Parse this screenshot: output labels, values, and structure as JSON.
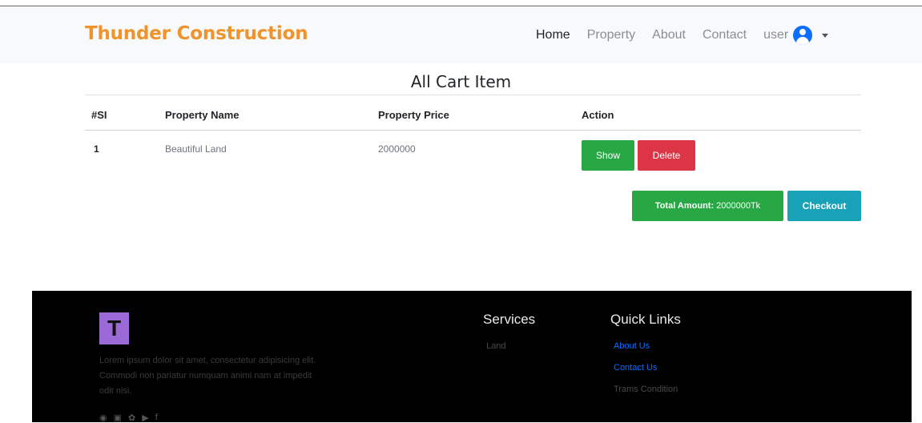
{
  "navbar": {
    "brand": "Thunder Construction",
    "items": [
      "Home",
      "Property",
      "About",
      "Contact"
    ],
    "user": "user"
  },
  "cart": {
    "title": "All Cart Item",
    "columns": [
      "#SI",
      "Property Name",
      "Property Price",
      "Action"
    ],
    "rows": [
      {
        "si": "1",
        "name": "Beautiful Land",
        "price": "2000000",
        "show": "Show",
        "delete": "Delete"
      }
    ],
    "total_label": "Total Amount:",
    "total_value": "2000000Tk",
    "checkout": "Checkout"
  },
  "footer": {
    "logo_letter": "T",
    "about": "Lorem ipsum dolor sit amet, consectetur adipisicing elit. Commodi non pariatur numquam animi nam at impedit odit nisi.",
    "services_title": "Services",
    "services": [
      "Land"
    ],
    "quicklinks_title": "Quick Links",
    "links": [
      "About Us",
      "Contact Us",
      "Trams Condition"
    ]
  },
  "colors": {
    "brand": "#f0932b",
    "primary": "#0d6efd",
    "success": "#28a745",
    "danger": "#dc3545",
    "info": "#17a2b8"
  }
}
